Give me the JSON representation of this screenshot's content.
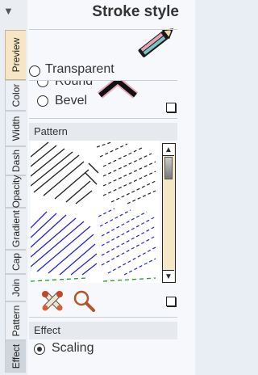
{
  "header": {
    "title": "Stroke style"
  },
  "tabs": [
    {
      "label": "Preview"
    },
    {
      "label": "Color"
    },
    {
      "label": "Width"
    },
    {
      "label": "Dash"
    },
    {
      "label": "Opacity"
    },
    {
      "label": "Gradient"
    },
    {
      "label": "Cap"
    },
    {
      "label": "Join"
    },
    {
      "label": "Pattern"
    },
    {
      "label": "Effect"
    }
  ],
  "fill": {
    "transparent_label": "Transparent"
  },
  "join": {
    "round_label": "Round",
    "bevel_label": "Bevel"
  },
  "pattern": {
    "section_label": "Pattern"
  },
  "effect": {
    "section_label": "Effect",
    "scaling_label": "Scaling"
  }
}
